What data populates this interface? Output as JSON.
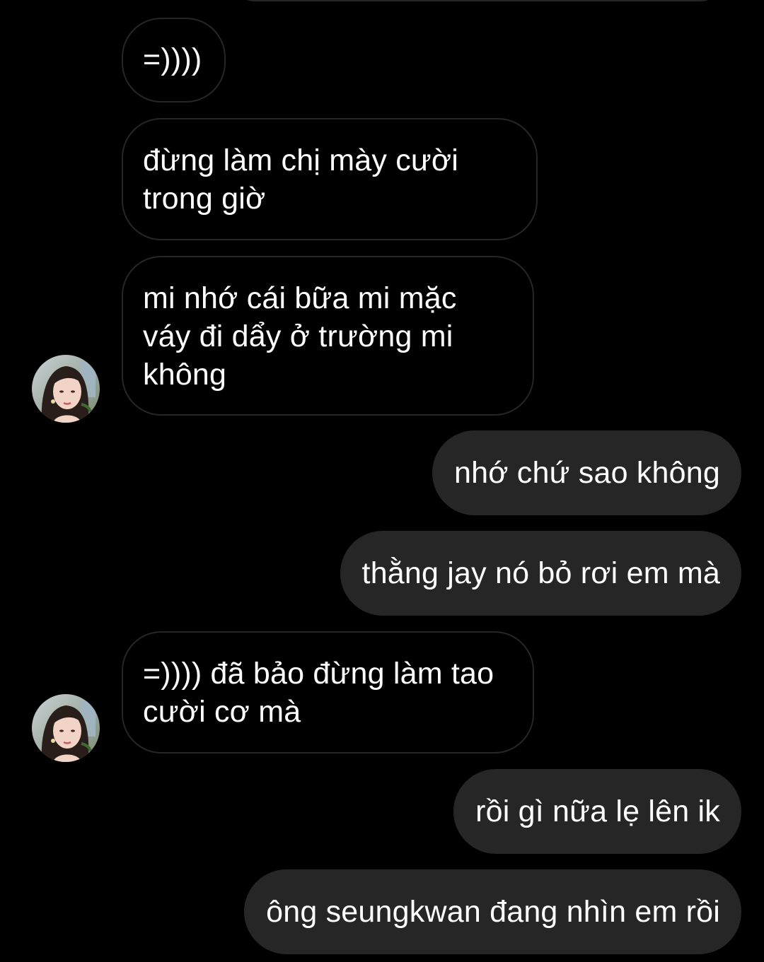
{
  "conversation": {
    "messages": [
      {
        "side": "received",
        "text": "=))))"
      },
      {
        "side": "received",
        "text": "đừng làm chị mày cười\ntrong giờ"
      },
      {
        "side": "received",
        "text": "mi nhớ cái bữa mi mặc\nváy đi dẩy ở trường mi\nkhông"
      },
      {
        "side": "sent",
        "text": "nhớ chứ sao không"
      },
      {
        "side": "sent",
        "text": "thằng jay nó bỏ rơi em mà"
      },
      {
        "side": "received",
        "text": "=)))) đã bảo đừng làm tao\ncười cơ mà"
      },
      {
        "side": "sent",
        "text": "rồi gì nữa lẹ lên ik"
      },
      {
        "side": "sent",
        "text": "ông seungkwan đang nhìn em rồi"
      }
    ]
  },
  "colors": {
    "background": "#000000",
    "sent_bubble": "#262626",
    "received_border": "#262626",
    "text": "#ffffff"
  },
  "icons": {
    "avatar": "contact-avatar-photo"
  }
}
